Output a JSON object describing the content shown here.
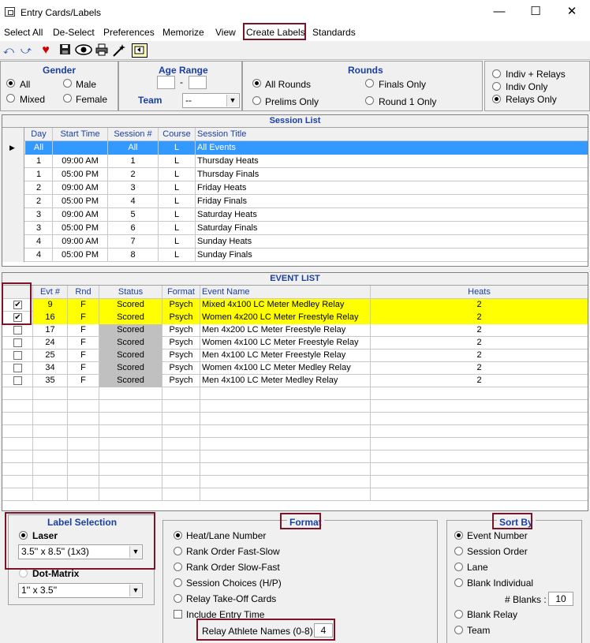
{
  "window": {
    "title": "Entry Cards/Labels",
    "minimize": "—",
    "maximize": "☐",
    "close": "✕"
  },
  "menu": [
    "Select All",
    "De-Select",
    "Preferences",
    "Memorize",
    "View",
    "Create Labels",
    "Standards"
  ],
  "toolbar_icons": [
    "undo-icon",
    "redo-icon",
    "heart-icon",
    "save-icon",
    "eye-icon",
    "print-icon",
    "wand-icon",
    "import-icon"
  ],
  "gender": {
    "title": "Gender",
    "all": "All",
    "male": "Male",
    "mixed": "Mixed",
    "female": "Female",
    "selected": "All"
  },
  "age_range": {
    "title": "Age Range",
    "from": "",
    "dash": "-",
    "to": "",
    "team_label": "Team",
    "team_value": "--"
  },
  "rounds": {
    "title": "Rounds",
    "all": "All Rounds",
    "finals": "Finals Only",
    "prelims": "Prelims Only",
    "round1": "Round 1 Only",
    "selected": "All Rounds"
  },
  "event_type": {
    "indiv_relays": "Indiv + Relays",
    "indiv_only": "Indiv Only",
    "relays_only": "Relays Only",
    "selected": "Relays Only"
  },
  "session_list": {
    "title": "Session List",
    "columns": [
      "Day",
      "Start Time",
      "Session #",
      "Course",
      "Session Title"
    ],
    "rows": [
      [
        "All",
        "",
        "All",
        "L",
        "All Events"
      ],
      [
        "1",
        "09:00 AM",
        "1",
        "L",
        "Thursday Heats"
      ],
      [
        "1",
        "05:00 PM",
        "2",
        "L",
        "Thursday Finals"
      ],
      [
        "2",
        "09:00 AM",
        "3",
        "L",
        "Friday Heats"
      ],
      [
        "2",
        "05:00 PM",
        "4",
        "L",
        "Friday Finals"
      ],
      [
        "3",
        "09:00 AM",
        "5",
        "L",
        "Saturday Heats"
      ],
      [
        "3",
        "05:00 PM",
        "6",
        "L",
        "Saturday Finals"
      ],
      [
        "4",
        "09:00 AM",
        "7",
        "L",
        "Sunday Heats"
      ],
      [
        "4",
        "05:00 PM",
        "8",
        "L",
        "Sunday Finals"
      ]
    ]
  },
  "event_list": {
    "title": "EVENT LIST",
    "columns": [
      "",
      "Evt #",
      "Rnd",
      "Status",
      "Format",
      "Event Name",
      "Heats"
    ],
    "rows": [
      {
        "checked": true,
        "evt": "9",
        "rnd": "F",
        "status": "Scored",
        "format": "Psych",
        "name": "Mixed 4x100 LC Meter Medley Relay",
        "heats": "2"
      },
      {
        "checked": true,
        "evt": "16",
        "rnd": "F",
        "status": "Scored",
        "format": "Psych",
        "name": "Women 4x200 LC Meter Freestyle Relay",
        "heats": "2"
      },
      {
        "checked": false,
        "evt": "17",
        "rnd": "F",
        "status": "Scored",
        "format": "Psych",
        "name": "Men 4x200 LC Meter Freestyle Relay",
        "heats": "2"
      },
      {
        "checked": false,
        "evt": "24",
        "rnd": "F",
        "status": "Scored",
        "format": "Psych",
        "name": "Women 4x100 LC Meter Freestyle Relay",
        "heats": "2"
      },
      {
        "checked": false,
        "evt": "25",
        "rnd": "F",
        "status": "Scored",
        "format": "Psych",
        "name": "Men 4x100 LC Meter Freestyle Relay",
        "heats": "2"
      },
      {
        "checked": false,
        "evt": "34",
        "rnd": "F",
        "status": "Scored",
        "format": "Psych",
        "name": "Women 4x100 LC Meter Medley Relay",
        "heats": "2"
      },
      {
        "checked": false,
        "evt": "35",
        "rnd": "F",
        "status": "Scored",
        "format": "Psych",
        "name": "Men 4x100 LC Meter Medley Relay",
        "heats": "2"
      }
    ]
  },
  "label_selection": {
    "title": "Label Selection",
    "laser": "Laser",
    "laser_size": "3.5'' x 8.5'' (1x3)",
    "dot_matrix": "Dot-Matrix",
    "dot_size": "1'' x 3.5''",
    "selected": "Laser"
  },
  "format": {
    "title": "Format",
    "options": [
      "Heat/Lane Number",
      "Rank Order Fast-Slow",
      "Rank Order Slow-Fast",
      "Session Choices (H/P)",
      "Relay Take-Off Cards"
    ],
    "selected": "Heat/Lane Number",
    "include_entry_time": "Include Entry Time",
    "relay_names_label": "Relay Athlete Names (0-8) :",
    "relay_names_value": "4"
  },
  "sort_by": {
    "title": "Sort By",
    "options": [
      "Event Number",
      "Session Order",
      "Lane",
      "Blank Individual"
    ],
    "selected": "Event Number",
    "blanks_label": "# Blanks :",
    "blanks_value": "10",
    "options2": [
      "Blank Relay",
      "Team"
    ]
  },
  "colors": {
    "accent_blue": "#1a3fa0",
    "highlight_yellow": "#ffff00",
    "selection_blue": "#3399ff",
    "annotation_red": "#7b1428"
  }
}
